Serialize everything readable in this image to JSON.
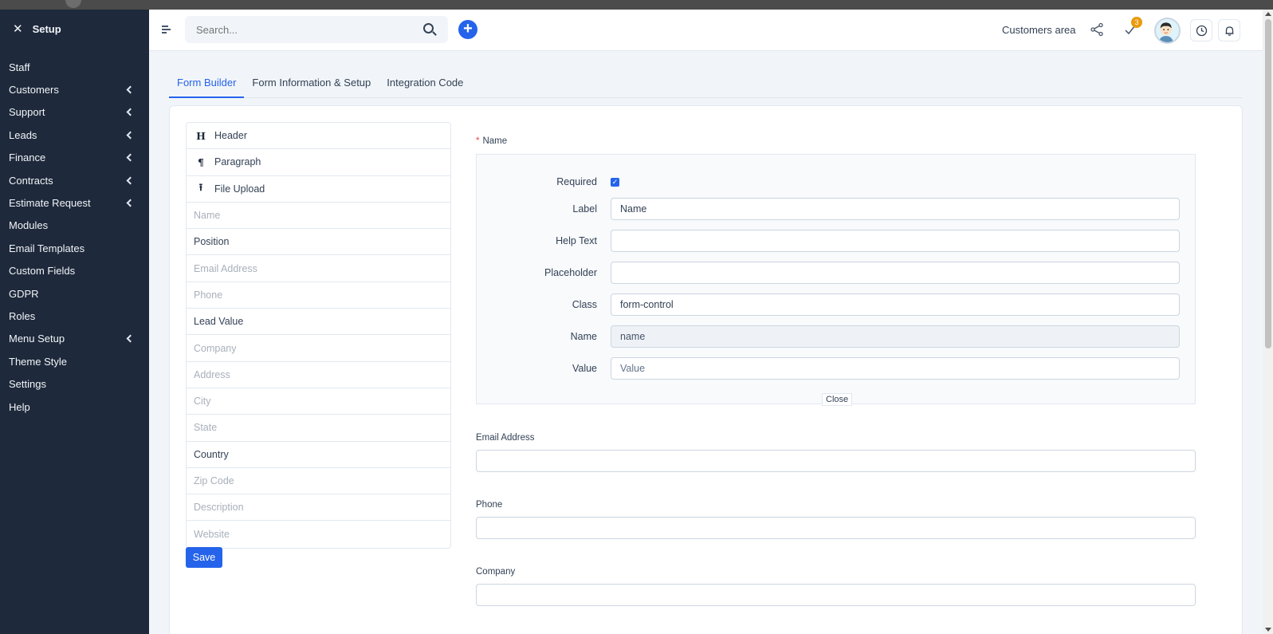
{
  "sidebar": {
    "title": "Setup",
    "items": [
      {
        "label": "Staff",
        "has_children": false
      },
      {
        "label": "Customers",
        "has_children": true
      },
      {
        "label": "Support",
        "has_children": true
      },
      {
        "label": "Leads",
        "has_children": true
      },
      {
        "label": "Finance",
        "has_children": true
      },
      {
        "label": "Contracts",
        "has_children": true
      },
      {
        "label": "Estimate Request",
        "has_children": true
      },
      {
        "label": "Modules",
        "has_children": false
      },
      {
        "label": "Email Templates",
        "has_children": false
      },
      {
        "label": "Custom Fields",
        "has_children": false
      },
      {
        "label": "GDPR",
        "has_children": false
      },
      {
        "label": "Roles",
        "has_children": false
      },
      {
        "label": "Menu Setup",
        "has_children": true
      },
      {
        "label": "Theme Style",
        "has_children": false
      },
      {
        "label": "Settings",
        "has_children": false
      },
      {
        "label": "Help",
        "has_children": false
      }
    ]
  },
  "topbar": {
    "search_placeholder": "Search...",
    "customers_area": "Customers area",
    "todo_badge": "3"
  },
  "tabs": [
    {
      "label": "Form Builder",
      "active": true
    },
    {
      "label": "Form Information & Setup",
      "active": false
    },
    {
      "label": "Integration Code",
      "active": false
    }
  ],
  "palette": {
    "items": [
      {
        "label": "Header",
        "icon": "H",
        "icon_name": "header-icon",
        "style": "dark"
      },
      {
        "label": "Paragraph",
        "icon": "¶",
        "icon_name": "paragraph-icon",
        "style": "dark"
      },
      {
        "label": "File Upload",
        "icon": "⭱",
        "icon_name": "upload-icon",
        "style": "dark"
      },
      {
        "label": "Name",
        "style": "faded"
      },
      {
        "label": "Position",
        "style": "dark"
      },
      {
        "label": "Email Address",
        "style": "faded"
      },
      {
        "label": "Phone",
        "style": "faded"
      },
      {
        "label": "Lead Value",
        "style": "dark"
      },
      {
        "label": "Company",
        "style": "faded"
      },
      {
        "label": "Address",
        "style": "faded"
      },
      {
        "label": "City",
        "style": "faded"
      },
      {
        "label": "State",
        "style": "faded"
      },
      {
        "label": "Country",
        "style": "dark"
      },
      {
        "label": "Zip Code",
        "style": "faded"
      },
      {
        "label": "Description",
        "style": "faded"
      },
      {
        "label": "Website",
        "style": "faded"
      }
    ],
    "save_label": "Save"
  },
  "editor": {
    "field_title": "Name",
    "required_label": "Required",
    "required_checked": true,
    "label_label": "Label",
    "label_value": "Name",
    "help_text_label": "Help Text",
    "help_text_value": "",
    "placeholder_label": "Placeholder",
    "placeholder_value": "",
    "class_label": "Class",
    "class_value": "form-control",
    "name_label": "Name",
    "name_value": "name",
    "value_label": "Value",
    "value_placeholder": "Value",
    "close_label": "Close"
  },
  "preview_fields": [
    {
      "label": "Email Address"
    },
    {
      "label": "Phone"
    },
    {
      "label": "Company"
    }
  ],
  "colors": {
    "sidebar_bg": "#1e293b",
    "accent": "#2563eb",
    "badge": "#ea9a0c",
    "required_star": "#ef4444"
  }
}
